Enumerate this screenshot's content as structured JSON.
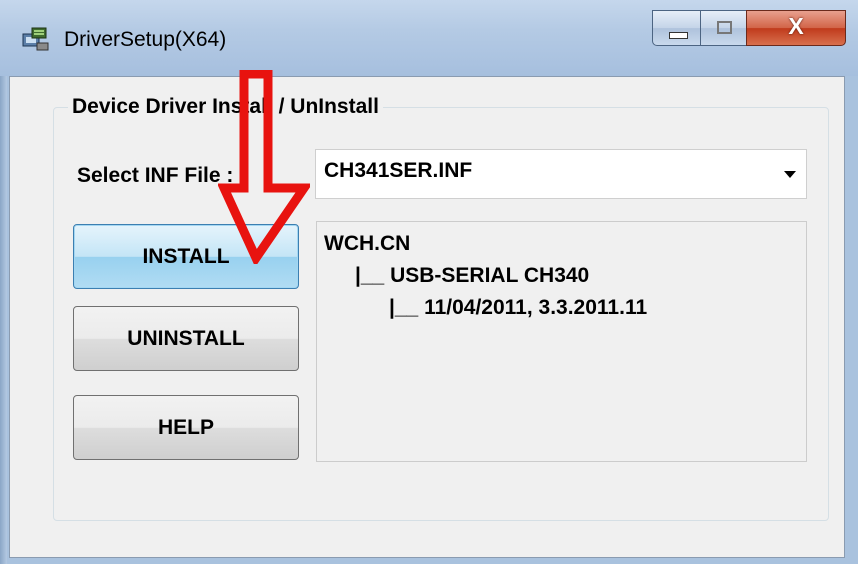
{
  "window": {
    "title": "DriverSetup(X64)",
    "app_icon": "driver-setup-icon",
    "controls": {
      "minimize_icon": "minimize-icon",
      "maximize_icon": "maximize-icon",
      "close_glyph": "X"
    }
  },
  "group": {
    "legend": "Device Driver Install / UnInstall"
  },
  "inf": {
    "label": "Select INF File :",
    "selected": "CH341SER.INF"
  },
  "buttons": {
    "install": "INSTALL",
    "uninstall": "UNINSTALL",
    "help": "HELP"
  },
  "info": {
    "lines": [
      "WCH.CN",
      "|__ USB-SERIAL CH340",
      "|__ 11/04/2011, 3.3.2011.11"
    ]
  },
  "annotation": {
    "arrow_color": "#e8130f",
    "arrow_icon": "red-down-arrow"
  }
}
